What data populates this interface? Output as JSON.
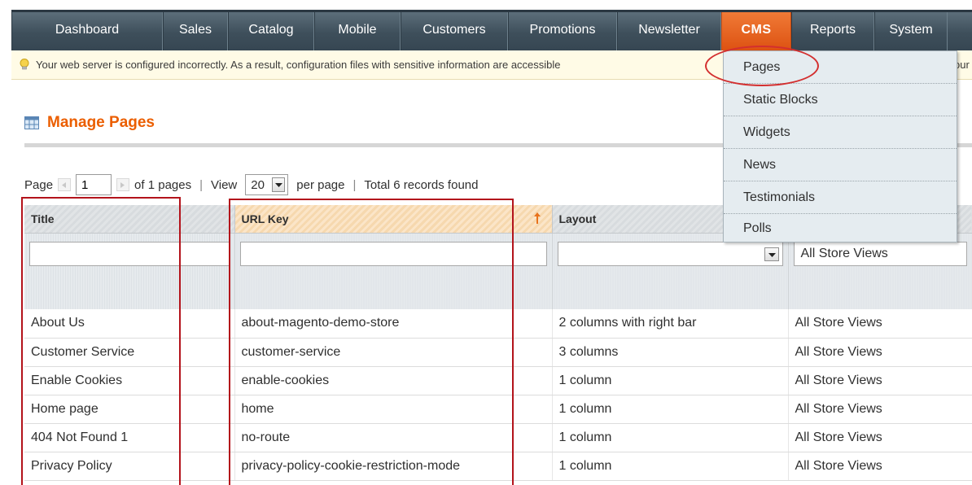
{
  "nav": {
    "items": [
      {
        "label": "Dashboard",
        "width": 186
      },
      {
        "label": "Sales",
        "width": 80
      },
      {
        "label": "Catalog",
        "width": 106
      },
      {
        "label": "Mobile",
        "width": 106
      },
      {
        "label": "Customers",
        "width": 132
      },
      {
        "label": "Promotions",
        "width": 134
      },
      {
        "label": "Newsletter",
        "width": 128
      },
      {
        "label": "CMS",
        "width": 86
      },
      {
        "label": "Reports",
        "width": 102
      },
      {
        "label": "System",
        "width": 90
      }
    ]
  },
  "notice": {
    "text": "Your web server is configured incorrectly. As a result, configuration files with sensitive information are accessible",
    "tail": "our"
  },
  "header": {
    "title": "Manage Pages"
  },
  "pager": {
    "page_label": "Page",
    "page_value": "1",
    "of_pages": "of 1 pages",
    "view_label": "View",
    "view_value": "20",
    "per_page": "per page",
    "total": "Total 6 records found"
  },
  "grid": {
    "columns": [
      "Title",
      "URL Key",
      "Layout",
      ""
    ],
    "store_filter": "All Store Views",
    "rows": [
      {
        "title": "About Us",
        "url_key": "about-magento-demo-store",
        "layout": "2 columns with right bar",
        "store": "All Store Views"
      },
      {
        "title": "Customer Service",
        "url_key": "customer-service",
        "layout": "3 columns",
        "store": "All Store Views"
      },
      {
        "title": "Enable Cookies",
        "url_key": "enable-cookies",
        "layout": "1 column",
        "store": "All Store Views"
      },
      {
        "title": "Home page",
        "url_key": "home",
        "layout": "1 column",
        "store": "All Store Views"
      },
      {
        "title": "404 Not Found 1",
        "url_key": "no-route",
        "layout": "1 column",
        "store": "All Store Views"
      },
      {
        "title": "Privacy Policy",
        "url_key": "privacy-policy-cookie-restriction-mode",
        "layout": "1 column",
        "store": "All Store Views"
      }
    ]
  },
  "cms_menu": {
    "items": [
      "Pages",
      "Static Blocks",
      "Widgets",
      "News",
      "Testimonials",
      "Polls"
    ]
  },
  "colors": {
    "accent": "#eb5e00",
    "nav_active": "#e8611f",
    "annotation": "#b3131b"
  }
}
